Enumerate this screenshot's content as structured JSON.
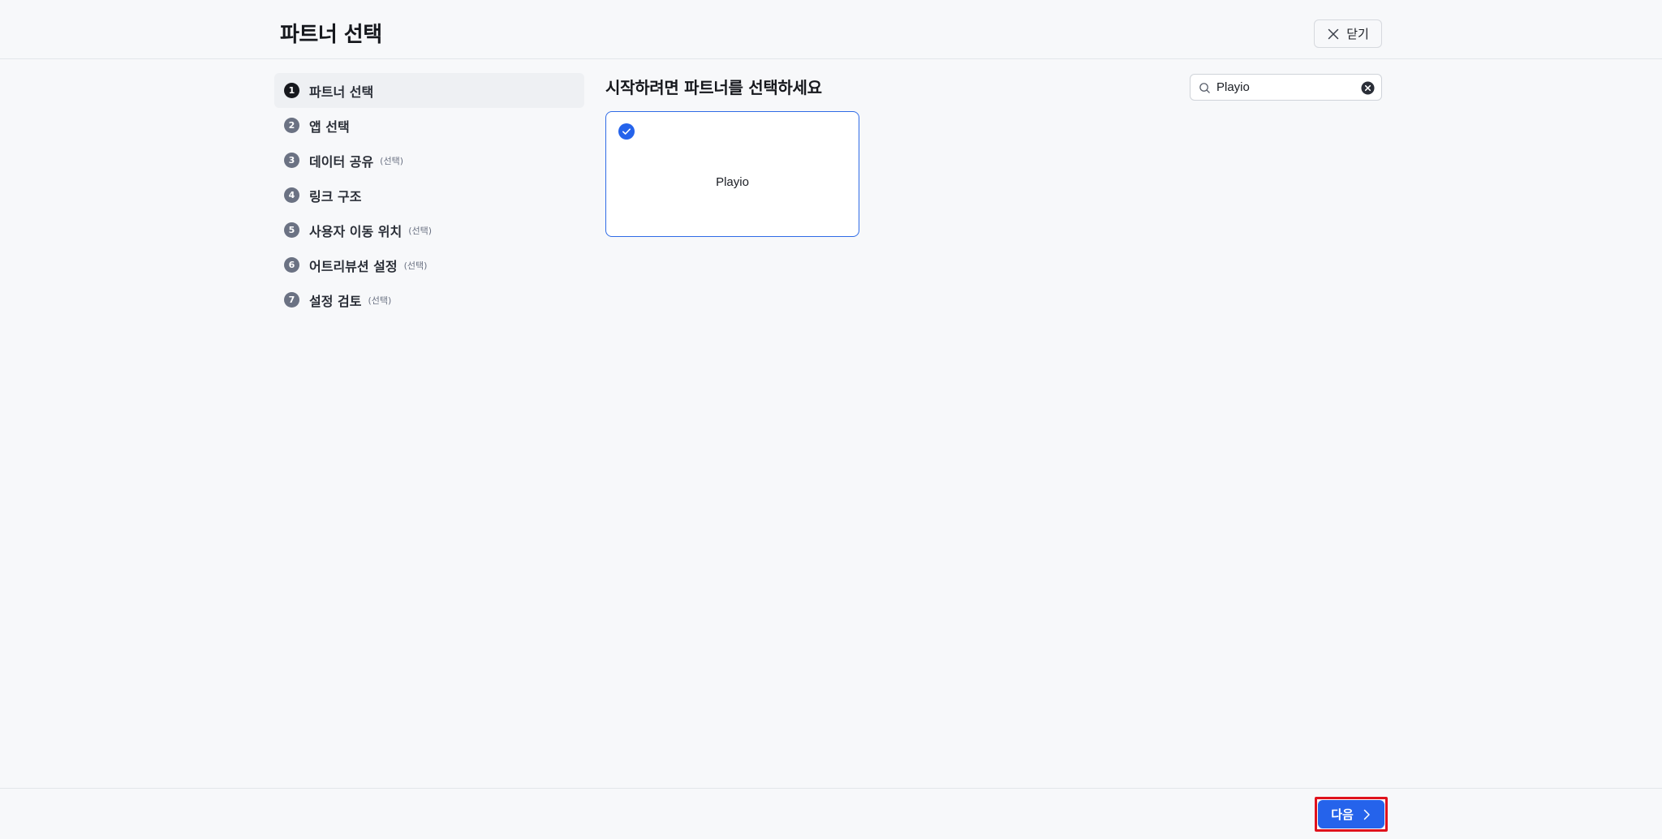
{
  "header": {
    "title": "파트너 선택",
    "close_label": "닫기"
  },
  "sidebar": {
    "steps": [
      {
        "number": "1",
        "label": "파트너 선택",
        "optional": ""
      },
      {
        "number": "2",
        "label": "앱 선택",
        "optional": ""
      },
      {
        "number": "3",
        "label": "데이터 공유",
        "optional": "(선택)"
      },
      {
        "number": "4",
        "label": "링크 구조",
        "optional": ""
      },
      {
        "number": "5",
        "label": "사용자 이동 위치",
        "optional": "(선택)"
      },
      {
        "number": "6",
        "label": "어트리뷰션 설정",
        "optional": "(선택)"
      },
      {
        "number": "7",
        "label": "설정 검토",
        "optional": "(선택)"
      }
    ]
  },
  "main": {
    "heading": "시작하려면 파트너를 선택하세요",
    "search": {
      "value": "Playio",
      "placeholder": ""
    },
    "partners": [
      {
        "name": "Playio",
        "selected": true
      }
    ]
  },
  "footer": {
    "next_label": "다음"
  },
  "colors": {
    "accent": "#2563eb",
    "highlight": "#e0121c"
  }
}
